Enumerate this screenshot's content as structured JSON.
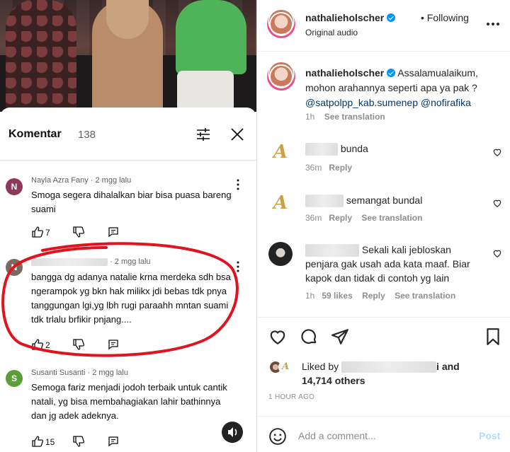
{
  "left": {
    "comments_title": "Komentar",
    "comments_count": "138",
    "comments": [
      {
        "avatar_letter": "N",
        "avatar_color": "#8b3a5a",
        "author": "Nayla Azra Fany",
        "time": "· 2 mgg lalu",
        "text": "Smoga segera dihalalkan biar bisa puasa bareng suami",
        "likes": "7"
      },
      {
        "avatar_letter": "N",
        "avatar_color": "#7a6a62",
        "author": "",
        "time": "· 2 mgg lalu",
        "text": "bangga dg adanya natalie krna merdeka sdh bsa ngerampok yg bkn hak milikx jdi bebas tdk pnya tanggungan lgi,yg lbh rugi paraahh mntan suami tdk trlalu brfikir pnjang....",
        "likes": "2"
      },
      {
        "avatar_letter": "S",
        "avatar_color": "#5c9e3a",
        "author": "Susanti Susanti",
        "time": "· 2 mgg lalu",
        "text": "Semoga fariz menjadi jodoh terbaik untuk cantik natali, yg bisa membahagiakan lahir bathinnya dan jg adek adeknya.",
        "likes": "15"
      }
    ]
  },
  "right": {
    "header": {
      "username": "nathalieholscher",
      "following": "Following",
      "audio": "Original audio"
    },
    "caption": {
      "username": "nathalieholscher",
      "text": "Assalamualaikum, mohon arahannya seperti apa ya pak ?",
      "mention1": "@satpolpp_kab.sumenep",
      "mention2": "@nofirafika",
      "time": "1h",
      "see_translation": "See translation"
    },
    "comments": [
      {
        "text": "bunda",
        "time": "36m",
        "reply": "Reply",
        "likes": "",
        "see_translation": ""
      },
      {
        "text": "semangat bundal",
        "time": "36m",
        "reply": "Reply",
        "likes": "",
        "see_translation": "See translation"
      },
      {
        "text": "Sekali kali jebloskan penjara gak usah ada kata maaf. Biar kapok dan tidak di contoh yg lain",
        "time": "1h",
        "reply": "Reply",
        "likes": "59 likes",
        "see_translation": "See translation"
      }
    ],
    "liked_by_prefix": "Liked by",
    "liked_by_suffix": "i and",
    "liked_by_others": "14,714 others",
    "time_ago": "1 HOUR AGO",
    "add_comment_placeholder": "Add a comment...",
    "post_label": "Post"
  },
  "colors": {
    "verified": "#0095f6",
    "link": "#00376b",
    "red_highlight": "#e0141e",
    "post_disabled": "#b3dbff"
  },
  "icons": [
    "filter-icon",
    "close-icon",
    "more-vert-icon",
    "thumb-up-icon",
    "thumb-down-icon",
    "reply-icon",
    "volume-icon",
    "more-horiz-icon",
    "heart-icon",
    "comment-icon",
    "share-icon",
    "bookmark-icon",
    "emoji-icon",
    "verified-icon"
  ]
}
